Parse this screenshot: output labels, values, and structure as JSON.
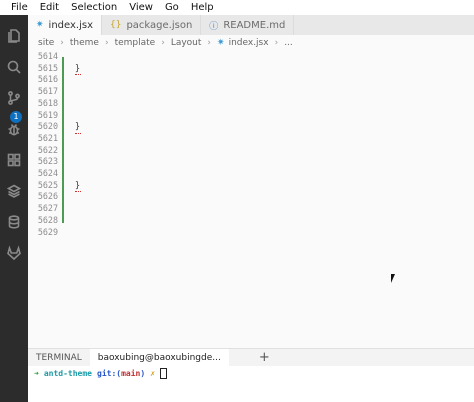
{
  "menu": [
    "File",
    "Edit",
    "Selection",
    "View",
    "Go",
    "Help"
  ],
  "activity_bar": {
    "items": [
      "files-icon",
      "search-icon",
      "source-control-icon",
      "debug-icon",
      "extensions-icon",
      "layers-icon",
      "database-icon",
      "gitlab-icon"
    ],
    "scm_badge": "1"
  },
  "tabs": [
    {
      "label": "index.jsx",
      "icon": "react-icon",
      "glyph": "✷"
    },
    {
      "label": "package.json",
      "icon": "json-icon",
      "glyph": "{}"
    },
    {
      "label": "README.md",
      "icon": "info-icon",
      "glyph": "ⓘ"
    }
  ],
  "breadcrumb": [
    "site",
    "theme",
    "template",
    "Layout",
    "index.jsx",
    "..."
  ],
  "editor": {
    "lines": [
      {
        "num": "5614",
        "code": ""
      },
      {
        "num": "5615",
        "code": "}"
      },
      {
        "num": "5616",
        "code": ""
      },
      {
        "num": "5617",
        "code": ""
      },
      {
        "num": "5618",
        "code": ""
      },
      {
        "num": "5619",
        "code": ""
      },
      {
        "num": "5620",
        "code": "}"
      },
      {
        "num": "5621",
        "code": ""
      },
      {
        "num": "5622",
        "code": ""
      },
      {
        "num": "5623",
        "code": ""
      },
      {
        "num": "5624",
        "code": ""
      },
      {
        "num": "5625",
        "code": "}"
      },
      {
        "num": "5626",
        "code": ""
      },
      {
        "num": "5627",
        "code": ""
      },
      {
        "num": "5628",
        "code": ""
      },
      {
        "num": "5629",
        "code": ""
      }
    ]
  },
  "panel": {
    "tabs": [
      "TERMINAL",
      "baoxubing@baoxubingde..."
    ],
    "add_label": "+"
  },
  "terminal": {
    "arrow": "➜",
    "dir": "antd-theme",
    "git_label": "git:(",
    "branch": "main",
    "git_close": ")",
    "dirty": "✗"
  },
  "colors": {
    "activity_bar": "#2c2c2c",
    "badge": "#0e70c0",
    "git_gutter": "#4b9b52",
    "editor_bg": "#fafafa"
  }
}
